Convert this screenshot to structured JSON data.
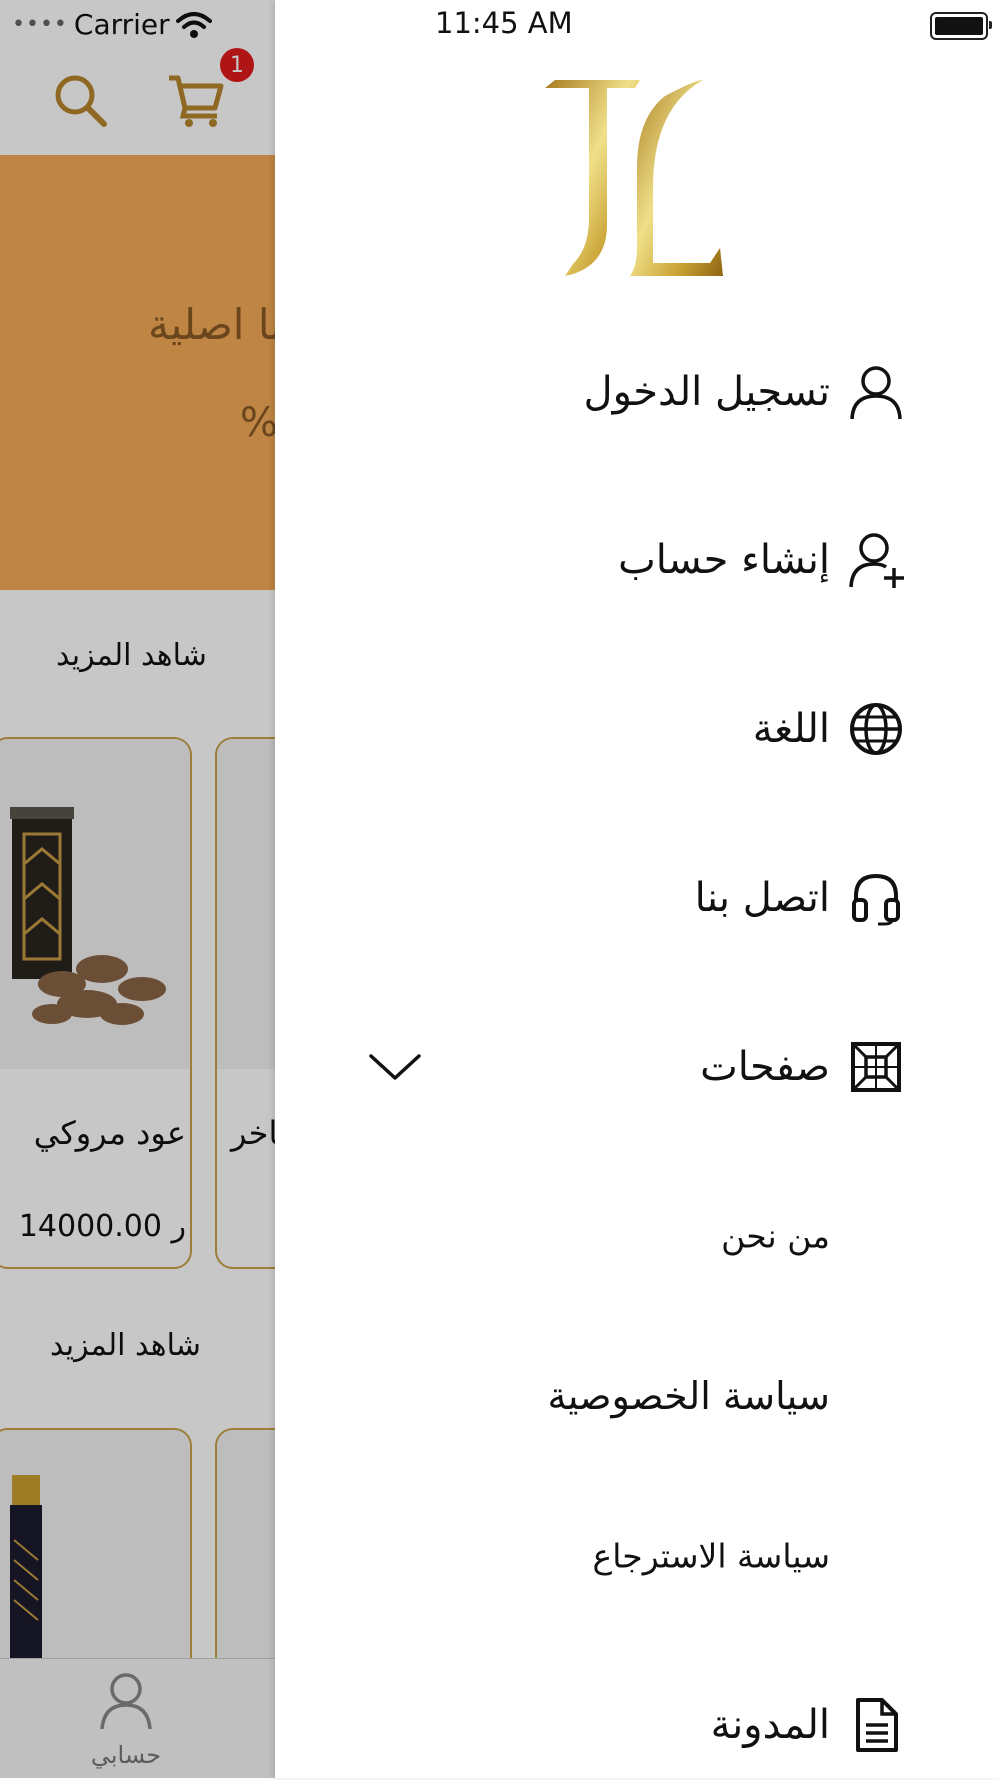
{
  "status_bar": {
    "carrier": "Carrier",
    "time": "11:45 AM"
  },
  "background": {
    "cart_badge": "1",
    "banner": {
      "line1": "تنا اصلية",
      "line2": "%"
    },
    "sections": [
      {
        "see_more": "شاهد المزيد"
      },
      {
        "see_more": "شاهد المزيد"
      }
    ],
    "products": [
      {
        "name": "عود مروكي",
        "price": "14000.00 ر"
      },
      {
        "name": "ـاخر",
        "price": ""
      }
    ],
    "bottom_nav": {
      "account_label": "حسابي"
    }
  },
  "drawer": {
    "items": [
      {
        "label": "تسجيل الدخول",
        "icon": "user-icon"
      },
      {
        "label": "إنشاء حساب",
        "icon": "user-plus-icon"
      },
      {
        "label": "اللغة",
        "icon": "globe-icon"
      },
      {
        "label": "اتصل بنا",
        "icon": "headset-icon"
      },
      {
        "label": "صفحات",
        "icon": "pages-icon",
        "expanded": true
      },
      {
        "label": "المدونة",
        "icon": "document-icon"
      }
    ],
    "sub_items": [
      {
        "label": "من نحن"
      },
      {
        "label": "سياسة الخصوصية"
      },
      {
        "label": "سياسة الاسترجاع"
      }
    ]
  },
  "colors": {
    "gold": "#c9a24a",
    "banner": "#f4ab58",
    "badge": "#e01b1b"
  }
}
